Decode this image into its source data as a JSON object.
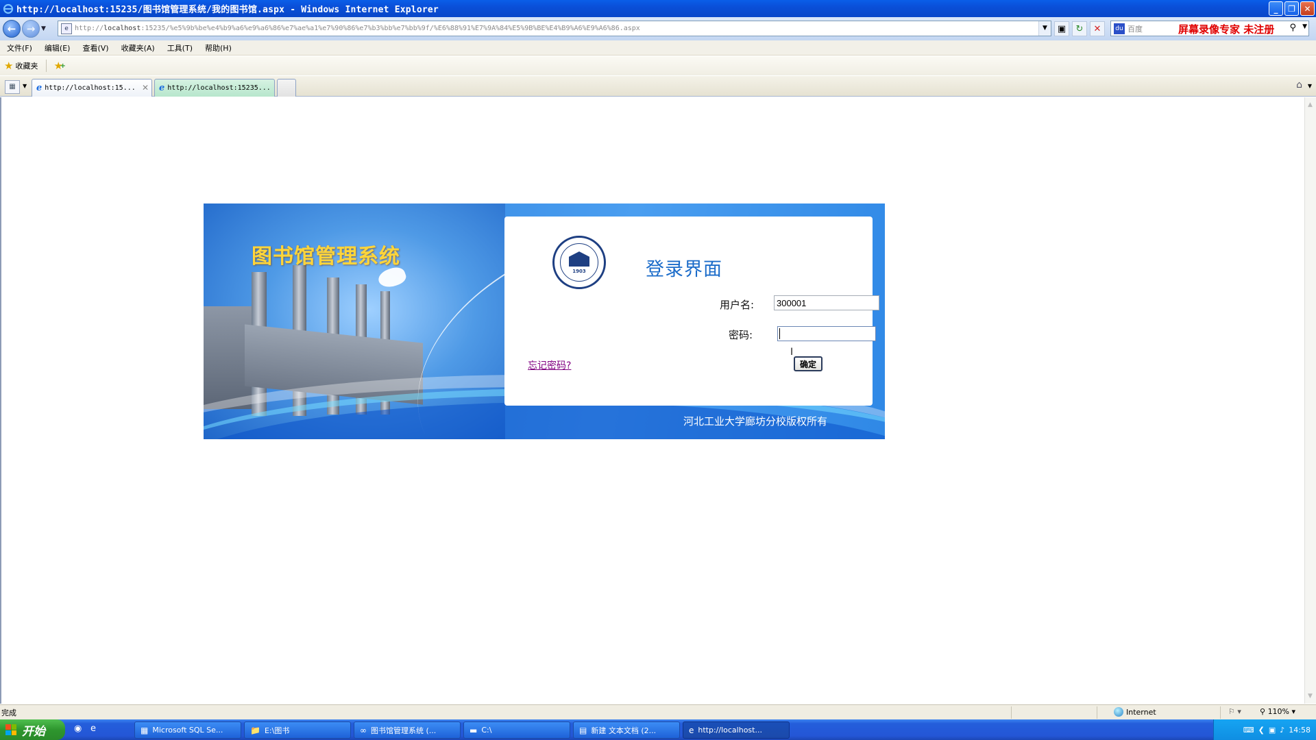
{
  "window": {
    "title": "http://localhost:15235/图书馆管理系统/我的图书馆.aspx - Windows Internet Explorer",
    "min": "_",
    "max": "❐",
    "close": "✕"
  },
  "address": {
    "url_host": "localhost",
    "url_prefix": "http://",
    "url_rest": ":15235/%e5%9b%be%e4%b9%a6%e9%a6%86%e7%ae%a1%e7%90%86%e7%b3%bb%e7%bb%9f/%E6%88%91%E7%9A%84%E5%9B%BE%E4%B9%A6%E9%A6%86.aspx"
  },
  "search": {
    "placeholder": "百度",
    "promo": "屏幕录像专家  未注册"
  },
  "menu": [
    "文件(F)",
    "编辑(E)",
    "查看(V)",
    "收藏夹(A)",
    "工具(T)",
    "帮助(H)"
  ],
  "favorites": {
    "label": "收藏夹"
  },
  "tabs": [
    {
      "label": "http://localhost:15..."
    },
    {
      "label": "http://localhost:15235..."
    }
  ],
  "banner": {
    "system_title": "图书馆管理系统",
    "seal_year": "1903",
    "copyright": "河北工业大学廊坊分校版权所有"
  },
  "login": {
    "heading": "登录界面",
    "username_label": "用户名:",
    "username_value": "300001",
    "password_label": "密码:",
    "password_value": "",
    "submit_label": "确定",
    "forgot_label": "忘记密码?"
  },
  "status": {
    "message": "完成",
    "zone": "Internet",
    "zoom": "110%"
  },
  "taskbar": {
    "start_label": "开始",
    "items": [
      {
        "label": "Microsoft SQL Se..."
      },
      {
        "label": "E:\\图书"
      },
      {
        "label": "图书馆管理系统 (..."
      },
      {
        "label": "C:\\"
      },
      {
        "label": "新建 文本文档 (2..."
      },
      {
        "label": "http://localhost..."
      }
    ],
    "clock": "14:58"
  },
  "colors": {
    "accent": "#1a6bc9",
    "title_gold": "#ffd53a",
    "link_visited": "#800080"
  }
}
